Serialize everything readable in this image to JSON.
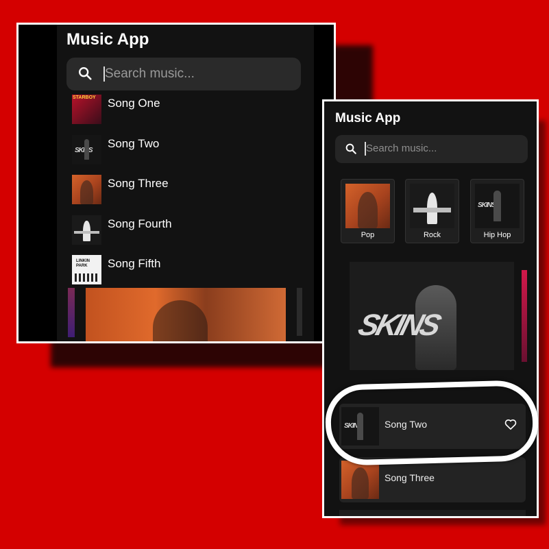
{
  "left_screen": {
    "title": "Music App",
    "search_placeholder": "Search music...",
    "songs": [
      {
        "label": "Song One",
        "cover_icon": "starboy-album-cover"
      },
      {
        "label": "Song Two",
        "cover_icon": "skins-album-cover"
      },
      {
        "label": "Song Three",
        "cover_icon": "post-malone-album-cover"
      },
      {
        "label": "Song Fourth",
        "cover_icon": "devil-album-cover"
      },
      {
        "label": "Song Fifth",
        "cover_icon": "linkin-park-album-cover"
      }
    ]
  },
  "right_screen": {
    "title": "Music App",
    "search_placeholder": "Search music...",
    "genres": [
      {
        "label": "Pop",
        "cover_icon": "post-malone-album-cover"
      },
      {
        "label": "Rock",
        "cover_icon": "devil-album-cover"
      },
      {
        "label": "Hip Hop",
        "cover_icon": "skins-album-cover"
      }
    ],
    "featured_cover_icon": "skins-featured-cover",
    "songs": [
      {
        "label": "Song Two",
        "cover_icon": "skins-album-cover",
        "favorite_icon": "heart-icon",
        "highlighted": true
      },
      {
        "label": "Song Three",
        "cover_icon": "post-malone-album-cover"
      }
    ]
  },
  "colors": {
    "background": "#d40000",
    "app_background": "#121212",
    "highlight_ring": "#ffffff"
  }
}
